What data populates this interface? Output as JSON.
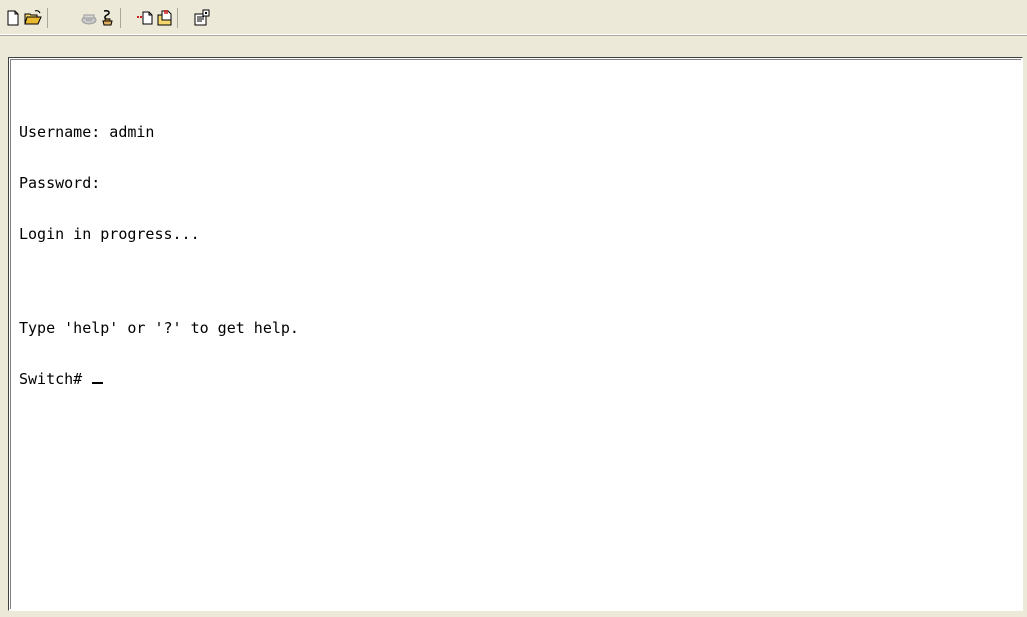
{
  "toolbar": {
    "buttons": [
      {
        "icon": "new-document-icon"
      },
      {
        "icon": "open-folder-icon"
      },
      {
        "icon": "disconnect-icon"
      },
      {
        "icon": "dial-icon"
      },
      {
        "icon": "send-file-icon"
      },
      {
        "icon": "receive-file-icon"
      },
      {
        "icon": "properties-icon"
      }
    ]
  },
  "terminal": {
    "lines": [
      "Username: admin",
      "Password:",
      "Login in progress...",
      "",
      "Type 'help' or '?' to get help.",
      "Switch# "
    ],
    "line1": "Username: admin",
    "line2": "Password:",
    "line3": "Login in progress...",
    "line4": "Type 'help' or '?' to get help.",
    "prompt": "Switch# "
  }
}
